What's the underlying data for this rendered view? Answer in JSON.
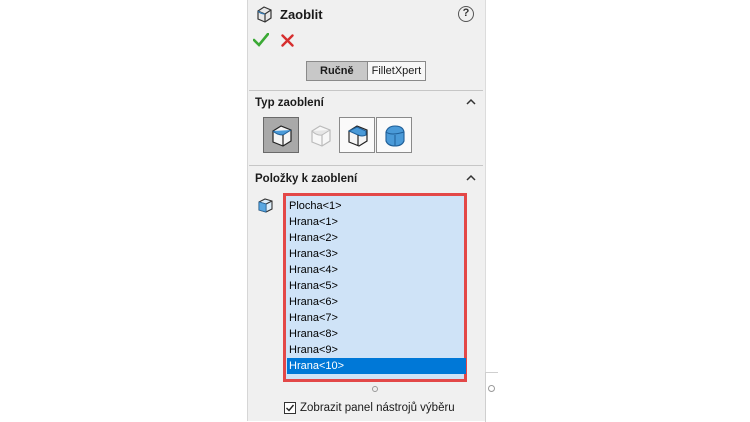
{
  "header": {
    "title": "Zaoblit",
    "icon": "fillet-feature-icon",
    "help_icon": "help-icon",
    "help_glyph": "?"
  },
  "actions": {
    "ok_icon": "checkmark-icon",
    "cancel_icon": "x-icon",
    "ok_color": "#3aa934",
    "cancel_color": "#d62e2e"
  },
  "mode_toggle": {
    "options": [
      "Ručně",
      "FilletXpert"
    ],
    "selected": "Ručně"
  },
  "fillet_type": {
    "title": "Typ zaoblení",
    "types": [
      {
        "icon": "constant-size-fillet-icon",
        "state": "selected"
      },
      {
        "icon": "variable-size-fillet-icon",
        "state": "disabled"
      },
      {
        "icon": "face-fillet-icon",
        "state": "normal"
      },
      {
        "icon": "full-round-fillet-icon",
        "state": "normal"
      }
    ]
  },
  "items_to_fillet": {
    "title": "Položky k zaoblení",
    "icon": "edges-faces-icon",
    "items": [
      "Plocha<1>",
      "Hrana<1>",
      "Hrana<2>",
      "Hrana<3>",
      "Hrana<4>",
      "Hrana<5>",
      "Hrana<6>",
      "Hrana<7>",
      "Hrana<8>",
      "Hrana<9>",
      "Hrana<10>"
    ],
    "selected_item": "Hrana<10>",
    "highlight_color": "#e34848"
  },
  "options": {
    "show_selection_toolbar_label": "Zobrazit panel nástrojů výběru",
    "show_selection_toolbar_checked": true
  }
}
